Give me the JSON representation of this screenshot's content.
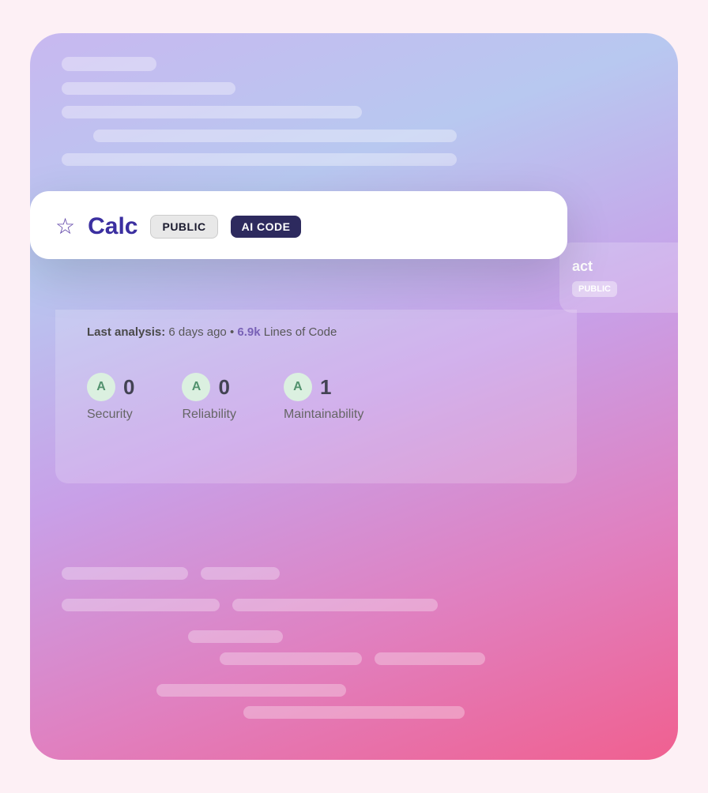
{
  "outer": {
    "gradient_start": "#c8b8f0",
    "gradient_end": "#f06090"
  },
  "back_card": {
    "title": "act",
    "badge_label": "PUBLIC"
  },
  "front_card": {
    "star_icon": "☆",
    "project_title": "Calc",
    "badge_public": "PUBLIC",
    "badge_ai_code": "AI CODE",
    "analysis_label": "Last analysis:",
    "analysis_time": "6 days ago",
    "analysis_separator": "•",
    "analysis_loc": "6.9k",
    "analysis_loc_label": "Lines of Code",
    "metrics": [
      {
        "grade": "A",
        "value": "0",
        "label": "Security"
      },
      {
        "grade": "A",
        "value": "0",
        "label": "Reliability"
      },
      {
        "grade": "A",
        "value": "1",
        "label": "Maintainability"
      }
    ]
  }
}
